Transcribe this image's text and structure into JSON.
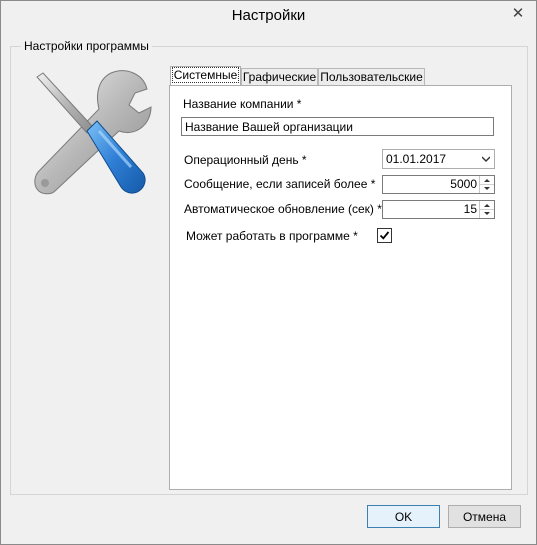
{
  "window": {
    "title": "Настройки"
  },
  "group": {
    "label": "Настройки программы"
  },
  "tabs": [
    {
      "label": "Системные",
      "active": true
    },
    {
      "label": "Графические",
      "active": false
    },
    {
      "label": "Пользовательские",
      "active": false
    }
  ],
  "form": {
    "company_label": "Название компании *",
    "company_value": "Название Вашей организации",
    "opday_label": "Операционный день *",
    "opday_value": "01.01.2017",
    "message_label": "Сообщение, если записей более *",
    "message_value": "5000",
    "refresh_label": "Автоматическое обновление (сек) *",
    "refresh_value": "15",
    "can_work_label": "Может работать в программе *",
    "can_work_checked": true
  },
  "buttons": {
    "ok": "OK",
    "cancel": "Отмена"
  },
  "icons": {
    "close": "close-icon",
    "tools": "tools-icon",
    "dropdown": "chevron-down-icon",
    "spin_up": "spin-up-icon",
    "spin_down": "spin-down-icon",
    "check": "check-icon"
  },
  "colors": {
    "accent": "#2f7fd6",
    "default_button_border": "#3c7fb1"
  }
}
